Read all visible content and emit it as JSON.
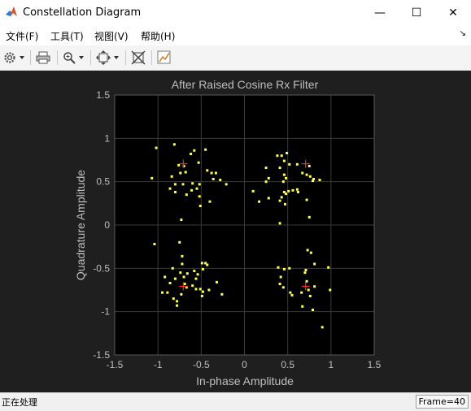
{
  "window": {
    "title": "Constellation Diagram",
    "controls": {
      "minimize": "—",
      "maximize": "☐",
      "close": "✕"
    }
  },
  "menu": [
    {
      "label": "文件(F)"
    },
    {
      "label": "工具(T)"
    },
    {
      "label": "视图(V)"
    },
    {
      "label": "帮助(H)"
    }
  ],
  "toolbar": {
    "icons": [
      "gear-icon",
      "print-icon",
      "zoom-icon",
      "fit-icon",
      "measure-icon",
      "cursor-icon"
    ]
  },
  "status": {
    "left": "正在处理",
    "right": "Frame=40"
  },
  "colors": {
    "figure_bg": "#1f1f1f",
    "axes_bg": "#000000",
    "grid": "#3a3a3a",
    "text": "#bfbfbf",
    "points": "#ffff55",
    "reference": "#ff2a2a"
  },
  "chart_data": {
    "type": "scatter",
    "title": "After Raised Cosine Rx Filter",
    "xlabel": "In-phase Amplitude",
    "ylabel": "Quadrature Amplitude",
    "xlim": [
      -1.5,
      1.5
    ],
    "ylim": [
      -1.5,
      1.5
    ],
    "xticks": [
      "-1.5",
      "-1",
      "-0.5",
      "0",
      "0.5",
      "1",
      "1.5"
    ],
    "yticks": [
      "1.5",
      "1",
      "0.5",
      "0",
      "-0.5",
      "-1",
      "-1.5"
    ],
    "grid": true,
    "reference_points": [
      [
        -0.707,
        0.707
      ],
      [
        0.707,
        0.707
      ],
      [
        -0.707,
        -0.707
      ],
      [
        0.707,
        -0.707
      ]
    ],
    "points": [
      [
        -1.02,
        0.89
      ],
      [
        -0.81,
        0.93
      ],
      [
        -0.7,
        0.68
      ],
      [
        -0.62,
        0.82
      ],
      [
        -0.58,
        0.86
      ],
      [
        -0.45,
        0.87
      ],
      [
        -0.53,
        0.72
      ],
      [
        -0.76,
        0.69
      ],
      [
        -0.74,
        0.6
      ],
      [
        -0.84,
        0.56
      ],
      [
        -0.68,
        0.61
      ],
      [
        -0.38,
        0.6
      ],
      [
        -0.33,
        0.6
      ],
      [
        -0.36,
        0.53
      ],
      [
        -0.43,
        0.63
      ],
      [
        -0.28,
        0.52
      ],
      [
        -1.07,
        0.54
      ],
      [
        -0.8,
        0.47
      ],
      [
        -0.6,
        0.48
      ],
      [
        -0.61,
        0.4
      ],
      [
        -0.71,
        0.47
      ],
      [
        -0.52,
        0.47
      ],
      [
        -0.55,
        0.42
      ],
      [
        -0.86,
        0.42
      ],
      [
        -0.8,
        0.38
      ],
      [
        -0.67,
        0.35
      ],
      [
        -0.52,
        0.33
      ],
      [
        -0.4,
        0.27
      ],
      [
        -0.21,
        0.47
      ],
      [
        -0.51,
        0.22
      ],
      [
        -0.73,
        0.06
      ],
      [
        -0.75,
        -0.2
      ],
      [
        0.38,
        0.8
      ],
      [
        0.43,
        0.8
      ],
      [
        0.49,
        0.83
      ],
      [
        0.46,
        0.74
      ],
      [
        0.52,
        0.7
      ],
      [
        0.41,
        0.66
      ],
      [
        0.25,
        0.66
      ],
      [
        0.46,
        0.58
      ],
      [
        0.48,
        0.54
      ],
      [
        0.45,
        0.5
      ],
      [
        0.28,
        0.54
      ],
      [
        0.25,
        0.5
      ],
      [
        0.67,
        0.6
      ],
      [
        0.72,
        0.58
      ],
      [
        0.76,
        0.56
      ],
      [
        0.8,
        0.53
      ],
      [
        0.79,
        0.51
      ],
      [
        0.87,
        0.52
      ],
      [
        0.75,
        0.68
      ],
      [
        0.61,
        0.7
      ],
      [
        0.61,
        0.41
      ],
      [
        0.56,
        0.4
      ],
      [
        0.62,
        0.38
      ],
      [
        0.51,
        0.39
      ],
      [
        0.1,
        0.39
      ],
      [
        0.17,
        0.27
      ],
      [
        0.28,
        0.31
      ],
      [
        0.48,
        0.36
      ],
      [
        0.46,
        0.38
      ],
      [
        0.43,
        0.32
      ],
      [
        0.41,
        0.28
      ],
      [
        0.47,
        0.24
      ],
      [
        0.72,
        0.29
      ],
      [
        0.75,
        0.09
      ],
      [
        0.41,
        0.02
      ],
      [
        -1.04,
        -0.22
      ],
      [
        -0.72,
        -0.36
      ],
      [
        -0.72,
        -0.45
      ],
      [
        -0.83,
        -0.5
      ],
      [
        -0.74,
        -0.55
      ],
      [
        -0.66,
        -0.56
      ],
      [
        -0.7,
        -0.6
      ],
      [
        -0.92,
        -0.6
      ],
      [
        -0.8,
        -0.62
      ],
      [
        -0.86,
        -0.67
      ],
      [
        -0.69,
        -0.68
      ],
      [
        -0.67,
        -0.72
      ],
      [
        -0.89,
        -0.78
      ],
      [
        -0.82,
        -0.85
      ],
      [
        -0.78,
        -0.88
      ],
      [
        -0.78,
        -0.93
      ],
      [
        -0.73,
        -0.8
      ],
      [
        -0.6,
        -0.7
      ],
      [
        -0.56,
        -0.74
      ],
      [
        -0.51,
        -0.74
      ],
      [
        -0.48,
        -0.77
      ],
      [
        -0.49,
        -0.82
      ],
      [
        -0.41,
        -0.75
      ],
      [
        -0.49,
        -0.44
      ],
      [
        -0.45,
        -0.44
      ],
      [
        -0.43,
        -0.46
      ],
      [
        -0.48,
        -0.51
      ],
      [
        -0.54,
        -0.57
      ],
      [
        -0.56,
        -0.62
      ],
      [
        -0.32,
        -0.66
      ],
      [
        -0.26,
        -0.8
      ],
      [
        -0.58,
        -0.53
      ],
      [
        -0.95,
        -0.78
      ],
      [
        0.39,
        -0.49
      ],
      [
        0.46,
        -0.51
      ],
      [
        0.52,
        -0.5
      ],
      [
        0.42,
        -0.6
      ],
      [
        0.41,
        -0.68
      ],
      [
        0.45,
        -0.72
      ],
      [
        0.53,
        -0.78
      ],
      [
        0.55,
        -0.81
      ],
      [
        0.72,
        -0.65
      ],
      [
        0.7,
        -0.55
      ],
      [
        0.71,
        -0.52
      ],
      [
        0.73,
        -0.29
      ],
      [
        0.77,
        -0.32
      ],
      [
        0.81,
        -0.45
      ],
      [
        0.81,
        -0.71
      ],
      [
        0.74,
        -0.75
      ],
      [
        0.76,
        -0.82
      ],
      [
        0.67,
        -0.94
      ],
      [
        0.79,
        -0.98
      ],
      [
        0.97,
        -0.49
      ],
      [
        0.99,
        -0.75
      ],
      [
        0.66,
        -0.78
      ],
      [
        0.9,
        -1.18
      ]
    ]
  }
}
